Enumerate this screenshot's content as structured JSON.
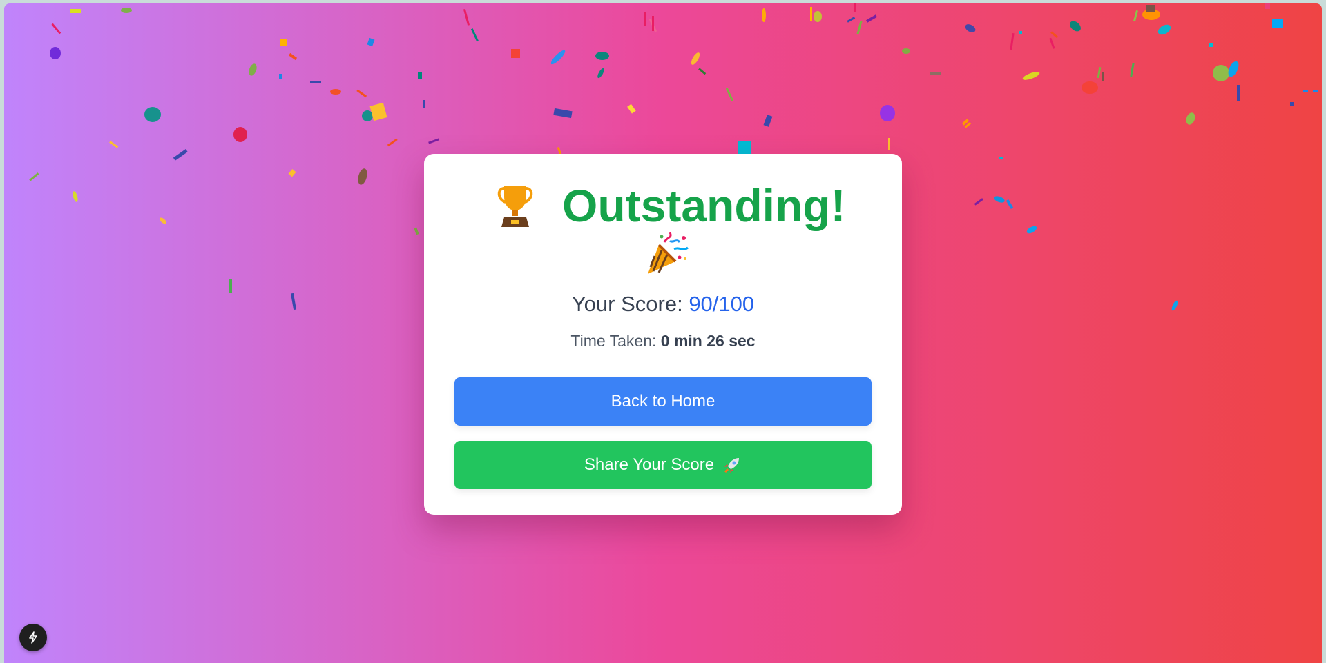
{
  "result": {
    "title": "Outstanding!",
    "trophy_icon": "trophy-icon",
    "party_icon": "party-popper-icon"
  },
  "score": {
    "label": "Your Score:",
    "value": "90/100"
  },
  "time": {
    "label": "Time Taken:",
    "value": "0 min 26 sec"
  },
  "actions": {
    "home_label": "Back to Home",
    "share_label": "Share Your Score",
    "share_icon": "rocket-icon"
  },
  "colors": {
    "title": "#16a34a",
    "score_value": "#2563eb",
    "home_button": "#3b82f6",
    "share_button": "#22c55e",
    "background_start": "#c084fc",
    "background_mid": "#ec4899",
    "background_end": "#ef4444"
  },
  "dev_tools": {
    "icon": "lightning-icon"
  }
}
